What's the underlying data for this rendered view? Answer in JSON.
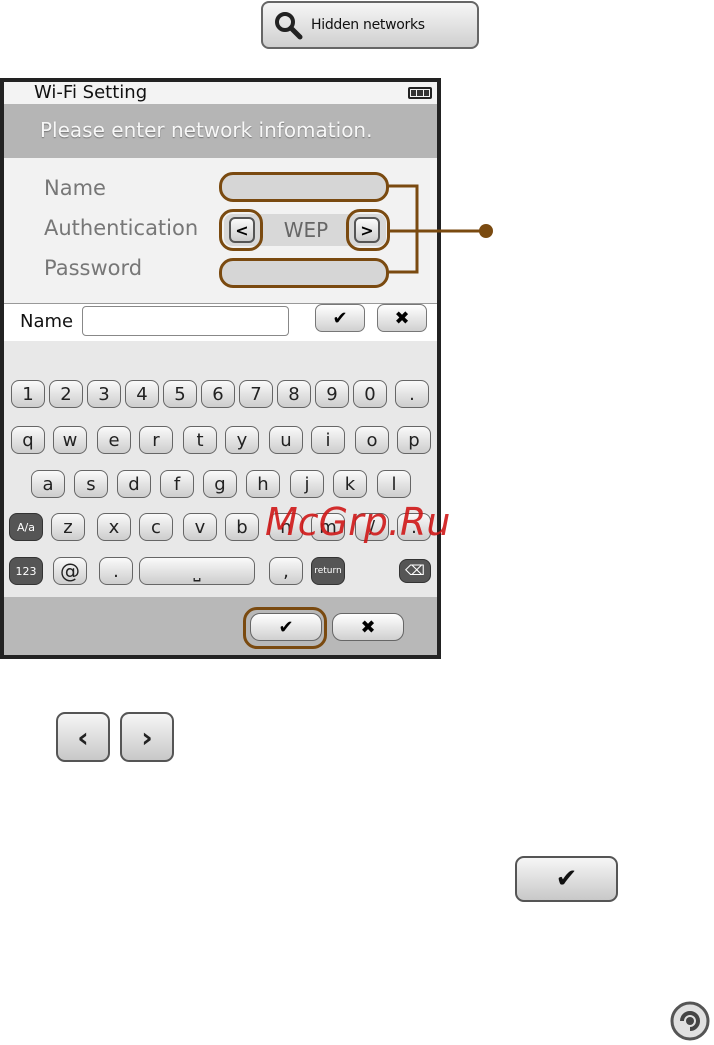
{
  "hidden_networks": {
    "label": "Hidden networks",
    "icon": "search-icon"
  },
  "screen": {
    "title": "Wi-Fi Setting",
    "header": "Please enter network infomation.",
    "form": {
      "name_label": "Name",
      "auth_label": "Authentication",
      "auth_value": "WEP",
      "password_label": "Password"
    },
    "keyboard": {
      "input_label": "Name",
      "input_value": "",
      "ok": "✔",
      "cancel": "✖",
      "row1": [
        "1",
        "2",
        "3",
        "4",
        "5",
        "6",
        "7",
        "8",
        "9",
        "0",
        "."
      ],
      "row2": [
        "q",
        "w",
        "e",
        "r",
        "t",
        "y",
        "u",
        "i",
        "o",
        "p"
      ],
      "row3": [
        "a",
        "s",
        "d",
        "f",
        "g",
        "h",
        "j",
        "k",
        "l"
      ],
      "row4": [
        "A/a",
        "z",
        "x",
        "c",
        "v",
        "b",
        "n",
        "m",
        "/",
        "."
      ],
      "row5": [
        "123",
        "@",
        ".",
        "⎵",
        ",",
        "return",
        "⌫"
      ]
    },
    "bottom": {
      "ok": "✔",
      "cancel": "✖"
    }
  },
  "nav_buttons": {
    "prev": "‹",
    "next": "›"
  },
  "confirm_button": "✔",
  "watermark": "McGrp.Ru",
  "colors": {
    "callout": "#7a4a10",
    "header": "#b5b5b5",
    "watermark": "#d01818"
  }
}
